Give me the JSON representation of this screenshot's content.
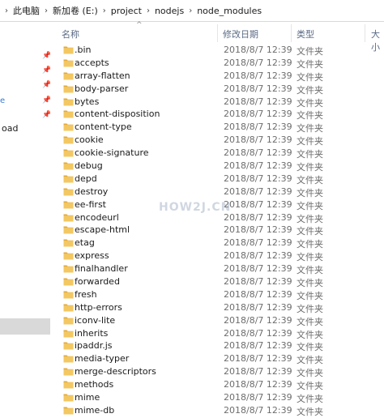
{
  "breadcrumb": [
    "此电脑",
    "新加卷 (E:)",
    "project",
    "nodejs",
    "node_modules"
  ],
  "columns": {
    "name": "名称",
    "date": "修改日期",
    "type": "类型",
    "size": "大小"
  },
  "nav": {
    "item_1": "e",
    "item_2": "oad"
  },
  "watermark": "HOW2J.CN",
  "colors": {
    "folder": "#f3c863",
    "folder_dark": "#e2a93a",
    "selection": "#d9d9d9"
  },
  "files": [
    {
      "name": ".bin",
      "date": "2018/8/7 12:39",
      "type": "文件夹"
    },
    {
      "name": "accepts",
      "date": "2018/8/7 12:39",
      "type": "文件夹"
    },
    {
      "name": "array-flatten",
      "date": "2018/8/7 12:39",
      "type": "文件夹"
    },
    {
      "name": "body-parser",
      "date": "2018/8/7 12:39",
      "type": "文件夹"
    },
    {
      "name": "bytes",
      "date": "2018/8/7 12:39",
      "type": "文件夹"
    },
    {
      "name": "content-disposition",
      "date": "2018/8/7 12:39",
      "type": "文件夹"
    },
    {
      "name": "content-type",
      "date": "2018/8/7 12:39",
      "type": "文件夹"
    },
    {
      "name": "cookie",
      "date": "2018/8/7 12:39",
      "type": "文件夹"
    },
    {
      "name": "cookie-signature",
      "date": "2018/8/7 12:39",
      "type": "文件夹"
    },
    {
      "name": "debug",
      "date": "2018/8/7 12:39",
      "type": "文件夹"
    },
    {
      "name": "depd",
      "date": "2018/8/7 12:39",
      "type": "文件夹"
    },
    {
      "name": "destroy",
      "date": "2018/8/7 12:39",
      "type": "文件夹"
    },
    {
      "name": "ee-first",
      "date": "2018/8/7 12:39",
      "type": "文件夹"
    },
    {
      "name": "encodeurl",
      "date": "2018/8/7 12:39",
      "type": "文件夹"
    },
    {
      "name": "escape-html",
      "date": "2018/8/7 12:39",
      "type": "文件夹"
    },
    {
      "name": "etag",
      "date": "2018/8/7 12:39",
      "type": "文件夹"
    },
    {
      "name": "express",
      "date": "2018/8/7 12:39",
      "type": "文件夹"
    },
    {
      "name": "finalhandler",
      "date": "2018/8/7 12:39",
      "type": "文件夹"
    },
    {
      "name": "forwarded",
      "date": "2018/8/7 12:39",
      "type": "文件夹"
    },
    {
      "name": "fresh",
      "date": "2018/8/7 12:39",
      "type": "文件夹"
    },
    {
      "name": "http-errors",
      "date": "2018/8/7 12:39",
      "type": "文件夹"
    },
    {
      "name": "iconv-lite",
      "date": "2018/8/7 12:39",
      "type": "文件夹"
    },
    {
      "name": "inherits",
      "date": "2018/8/7 12:39",
      "type": "文件夹"
    },
    {
      "name": "ipaddr.js",
      "date": "2018/8/7 12:39",
      "type": "文件夹"
    },
    {
      "name": "media-typer",
      "date": "2018/8/7 12:39",
      "type": "文件夹"
    },
    {
      "name": "merge-descriptors",
      "date": "2018/8/7 12:39",
      "type": "文件夹"
    },
    {
      "name": "methods",
      "date": "2018/8/7 12:39",
      "type": "文件夹"
    },
    {
      "name": "mime",
      "date": "2018/8/7 12:39",
      "type": "文件夹"
    },
    {
      "name": "mime-db",
      "date": "2018/8/7 12:39",
      "type": "文件夹"
    }
  ]
}
